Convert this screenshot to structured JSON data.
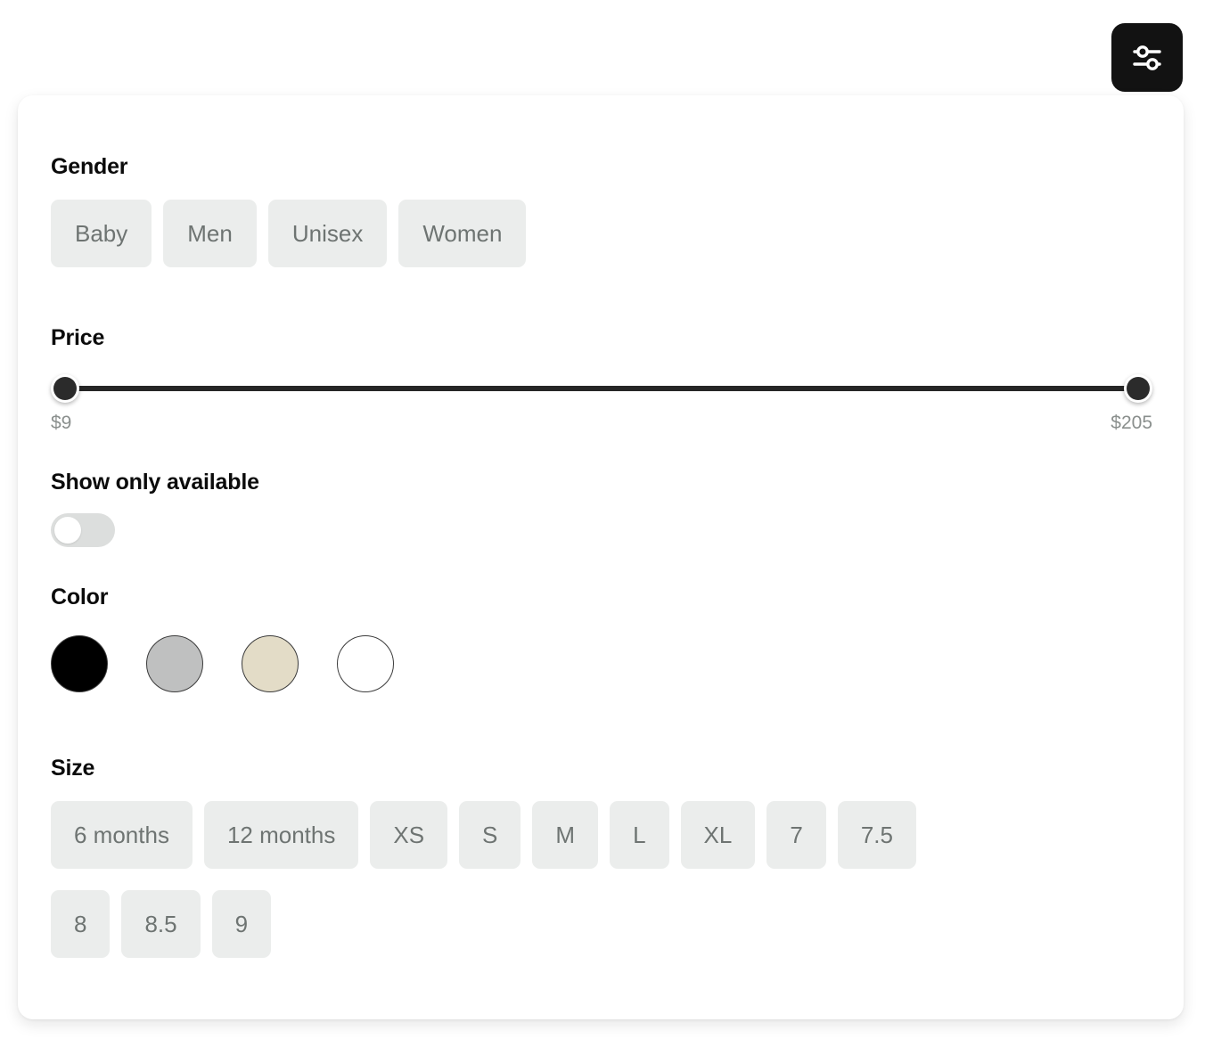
{
  "filter_button": {
    "icon": "sliders-icon",
    "label": "Filters",
    "background": "#121212",
    "icon_color": "#ffffff"
  },
  "panel": {
    "sections": {
      "gender": {
        "title": "Gender",
        "options": [
          "Baby",
          "Men",
          "Unisex",
          "Women"
        ]
      },
      "price": {
        "title": "Price",
        "min_label": "$9",
        "max_label": "$205",
        "min_value": 9,
        "max_value": 205,
        "handle_min_position_pct": 0,
        "handle_max_position_pct": 100,
        "track_color": "#262626",
        "thumb_color": "#2b2b2b"
      },
      "availability": {
        "title": "Show only available",
        "state": "off",
        "track_color": "#dcdedd",
        "knob_color": "#ffffff"
      },
      "color": {
        "title": "Color",
        "swatches": [
          {
            "name": "black",
            "hex": "#000000"
          },
          {
            "name": "gray",
            "hex": "#bfc0c0"
          },
          {
            "name": "beige",
            "hex": "#e3dcc7"
          },
          {
            "name": "white",
            "hex": "#ffffff"
          }
        ]
      },
      "size": {
        "title": "Size",
        "row1": [
          "6 months",
          "12 months",
          "XS",
          "S",
          "M",
          "L",
          "XL",
          "7",
          "7.5"
        ],
        "row2": [
          "8",
          "8.5",
          "9"
        ]
      }
    },
    "chip_style": {
      "background": "#ebedec",
      "text_color": "#6e7472"
    }
  }
}
